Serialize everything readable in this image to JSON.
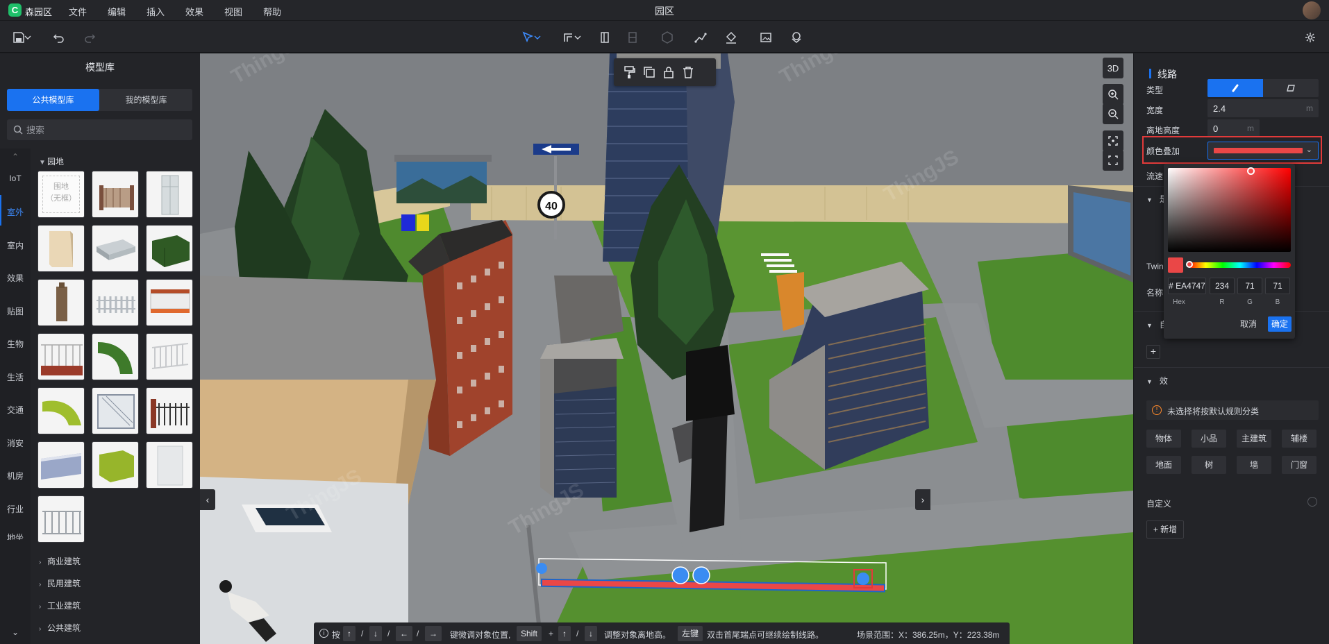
{
  "app": {
    "name": "森园区",
    "logo_char": "C",
    "window_title": "园区",
    "menu": [
      "文件",
      "编辑",
      "插入",
      "效果",
      "视图",
      "帮助"
    ]
  },
  "toolbar": {
    "icons": [
      "save-icon",
      "undo-icon",
      "redo-icon",
      "select-icon",
      "draw-line-icon",
      "door-icon",
      "wall-icon",
      "cube-icon",
      "path-icon",
      "paint-bucket-icon",
      "image-icon",
      "layers-icon",
      "settings-icon"
    ]
  },
  "left_panel": {
    "title": "模型库",
    "tabs": [
      "公共模型库",
      "我的模型库"
    ],
    "search_placeholder": "搜索",
    "categories": [
      "IoT",
      "室外",
      "室内",
      "效果",
      "贴图",
      "生物",
      "生活",
      "交通",
      "消安",
      "机房",
      "行业",
      "地坐"
    ],
    "active_category": "室外",
    "expanded_section": "园地",
    "first_tile_lines": [
      "围地",
      "（无框）"
    ],
    "sections_collapsed": [
      "商业建筑",
      "民用建筑",
      "工业建筑",
      "公共建筑"
    ]
  },
  "viewport": {
    "watermark": "ThingJS",
    "right_buttons": [
      "3D"
    ],
    "speed_sign": "40",
    "hint": {
      "press": "按",
      "keys": [
        "↑",
        "↓",
        "←",
        "→"
      ],
      "move_text": "键微调对象位置,",
      "shift": "Shift",
      "plus": "+",
      "height_text": "调整对象离地高。",
      "left_key": "左键",
      "dbl_text": "双击首尾端点可继续绘制线路。",
      "range_text": "场景范围：X：386.25m，Y：223.38m",
      "slash": "/"
    }
  },
  "right_panel": {
    "title": "线路",
    "type_label": "类型",
    "width_label": "宽度",
    "width_value": "2.4",
    "height_label": "离地高度",
    "height_value": "0",
    "unit": "m",
    "color_label": "颜色叠加",
    "color_value": "#EA4747",
    "flow_label": "流速",
    "section_twin_prefix": "Twin",
    "name_label": "名称",
    "picker": {
      "hex": "EA4747",
      "hex_prefix": "#",
      "r": "234",
      "g": "71",
      "b": "71",
      "labels": [
        "Hex",
        "R",
        "G",
        "B"
      ],
      "cancel": "取消",
      "ok": "确定",
      "hue_color": "#ff0000"
    },
    "notice": "未选择将按默认规则分类",
    "tags": [
      "物体",
      "小品",
      "主建筑",
      "辅楼",
      "地面",
      "树",
      "墙",
      "门窗"
    ],
    "custom_label": "自定义",
    "add_label": "新增",
    "sec_chars": [
      "是",
      "自",
      "效"
    ]
  },
  "colors": {
    "accent": "#1a72f0",
    "highlight": "#e23a3a",
    "line": "#ea4747"
  }
}
